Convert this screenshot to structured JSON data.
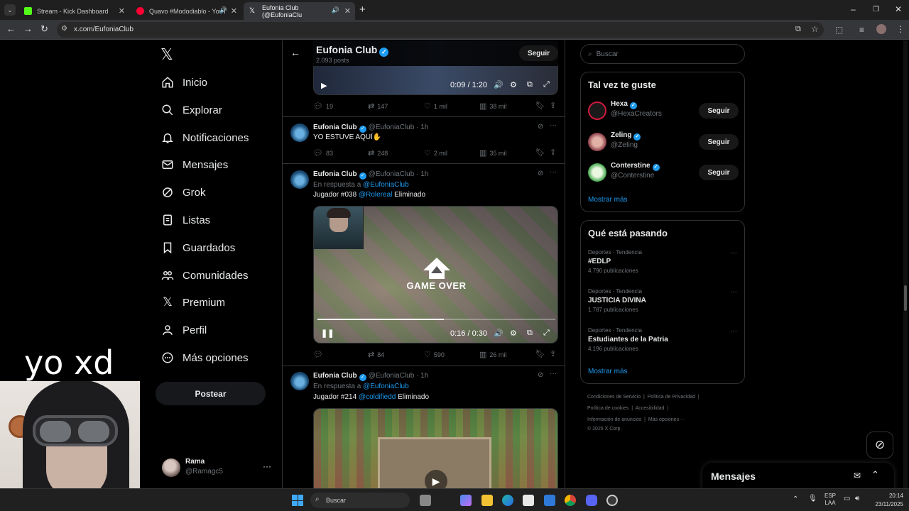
{
  "browser": {
    "tabs": [
      {
        "label": "Stream - Kick Dashboard",
        "color": "#53fc18"
      },
      {
        "label": "Quavo #Mododiablo - YouT",
        "color": "#ff0033"
      },
      {
        "label": "Eufonia Club (@EufoniaClu",
        "color": "#e7e9ea"
      }
    ],
    "new_tab": "+",
    "url": "x.com/EufoniaClub"
  },
  "sidebar": {
    "logo": "𝕏",
    "items": [
      {
        "label": "Inicio",
        "icon": "home-icon"
      },
      {
        "label": "Explorar",
        "icon": "search-icon"
      },
      {
        "label": "Notificaciones",
        "icon": "bell-icon"
      },
      {
        "label": "Mensajes",
        "icon": "mail-icon"
      },
      {
        "label": "Grok",
        "icon": "grok-icon"
      },
      {
        "label": "Listas",
        "icon": "list-icon"
      },
      {
        "label": "Guardados",
        "icon": "bookmark-icon"
      },
      {
        "label": "Comunidades",
        "icon": "communities-icon"
      },
      {
        "label": "Premium",
        "icon": "x-icon"
      },
      {
        "label": "Perfil",
        "icon": "person-icon"
      },
      {
        "label": "Más opciones",
        "icon": "more-circle-icon"
      }
    ],
    "post_button": "Postear",
    "account": {
      "name": "Rama",
      "handle": "@Ramagc5"
    }
  },
  "overlay": {
    "caption": "yo xd"
  },
  "profile_header": {
    "name": "Eufonia Club",
    "posts": "2.093 posts",
    "follow": "Seguir"
  },
  "tweet0": {
    "video_time": "0:09 / 1:20",
    "actions": {
      "replies": "19",
      "reposts": "147",
      "likes": "1 mil",
      "views": "38 mil"
    }
  },
  "tweet1": {
    "name": "Eufonia Club",
    "handle": "@EufoniaClub",
    "time": "· 1h",
    "text": "YO ESTUVE AQUÍ✋",
    "actions": {
      "replies": "83",
      "reposts": "248",
      "likes": "2 mil",
      "views": "35 mil"
    }
  },
  "tweet2": {
    "name": "Eufonia Club",
    "handle": "@EufoniaClub",
    "time": "· 1h",
    "reply_prefix": "En respuesta a",
    "reply_to": "@EufoniaClub",
    "text_a": "Jugador #038",
    "mention": "@Rolereal",
    "text_b": "Eliminado",
    "video_overlay": "GAME OVER",
    "video_time": "0:16 / 0:30",
    "actions": {
      "replies": "",
      "reposts": "84",
      "likes": "590",
      "views": "26 mil"
    }
  },
  "tweet3": {
    "name": "Eufonia Club",
    "handle": "@EufoniaClub",
    "time": "· 1h",
    "reply_prefix": "En respuesta a",
    "reply_to": "@EufoniaClub",
    "text_a": "Jugador #214",
    "mention": "@coldifiedd",
    "text_b": "Eliminado"
  },
  "right": {
    "search_placeholder": "Buscar",
    "suggest_title": "Tal vez te guste",
    "suggestions": [
      {
        "name": "Hexa",
        "handle": "@HexaCreators",
        "follow": "Seguir",
        "color": "#d01a3c"
      },
      {
        "name": "Zeling",
        "handle": "@ZeIing",
        "follow": "Seguir",
        "color": "#b0545f"
      },
      {
        "name": "Conterstine",
        "handle": "@Conterstine",
        "follow": "Seguir",
        "color": "#3fa64a"
      }
    ],
    "show_more": "Mostrar más",
    "trends_title": "Qué está pasando",
    "trends": [
      {
        "category": "Deportes · Tendencia",
        "name": "#EDLP",
        "posts": "4.790 publicaciones"
      },
      {
        "category": "Deportes · Tendencia",
        "name": "JUSTICIA DIVINA",
        "posts": "1.787 publicaciones"
      },
      {
        "category": "Deportes · Tendencia",
        "name": "Estudiantes de la Patria",
        "posts": "4.196 publicaciones"
      }
    ],
    "trends_more": "Mostrar más",
    "footer": {
      "line1_a": "Condiciones de Servicio",
      "line1_b": "Política de Privacidad",
      "line2_a": "Política de cookies",
      "line2_b": "Accesibilidad",
      "line3_a": "Información de anuncios",
      "line3_b": "Más opciones ···",
      "copyright": "© 2025 X Corp."
    },
    "messages_title": "Mensajes"
  },
  "taskbar": {
    "search": "Buscar",
    "lang": "ESP",
    "lang2": "LAA",
    "time": "20:14",
    "date": "23/11/2025"
  }
}
